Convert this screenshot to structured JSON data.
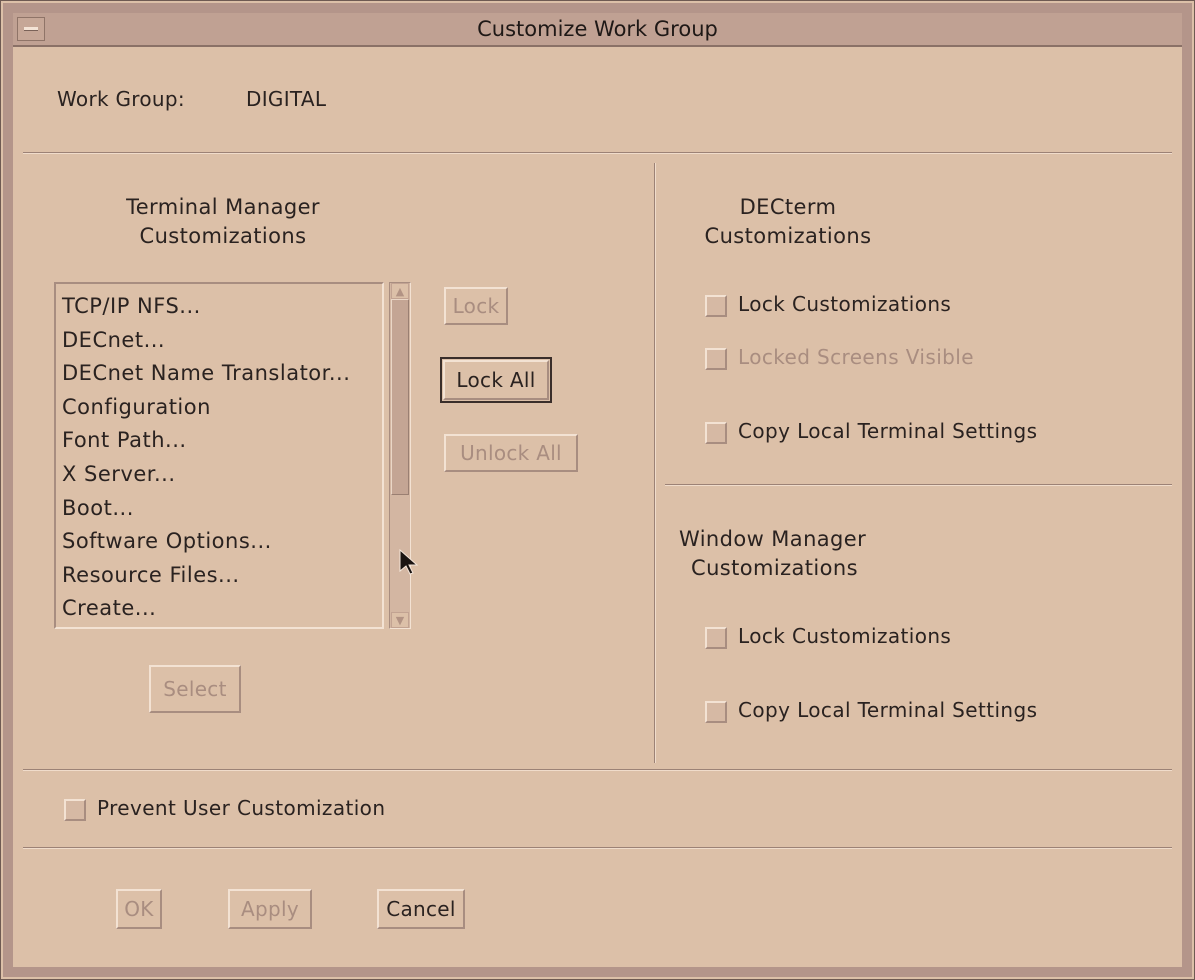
{
  "window": {
    "title": "Customize Work Group"
  },
  "work_group": {
    "label": "Work Group:",
    "value": "DIGITAL"
  },
  "terminal_manager": {
    "heading_line1": "Terminal Manager",
    "heading_line2": "Customizations",
    "items": [
      "TCP/IP NFS...",
      "DECnet...",
      "DECnet Name Translator...",
      "Configuration",
      "Font Path...",
      "X Server...",
      "Boot...",
      "Software Options...",
      "Resource Files...",
      "Create..."
    ],
    "lock_label": "Lock",
    "lock_all_label": "Lock All",
    "unlock_all_label": "Unlock All",
    "select_label": "Select"
  },
  "decterm": {
    "heading_line1": "DECterm",
    "heading_line2": "Customizations",
    "lock_customizations": "Lock Customizations",
    "locked_screens_visible": "Locked Screens Visible",
    "copy_local_settings": "Copy Local Terminal Settings"
  },
  "window_manager": {
    "heading_line1": "Window Manager",
    "heading_line2": "Customizations",
    "lock_customizations": "Lock Customizations",
    "copy_local_settings": "Copy Local Terminal Settings"
  },
  "prevent_user_customization": "Prevent User Customization",
  "footer": {
    "ok_label": "OK",
    "apply_label": "Apply",
    "cancel_label": "Cancel"
  }
}
